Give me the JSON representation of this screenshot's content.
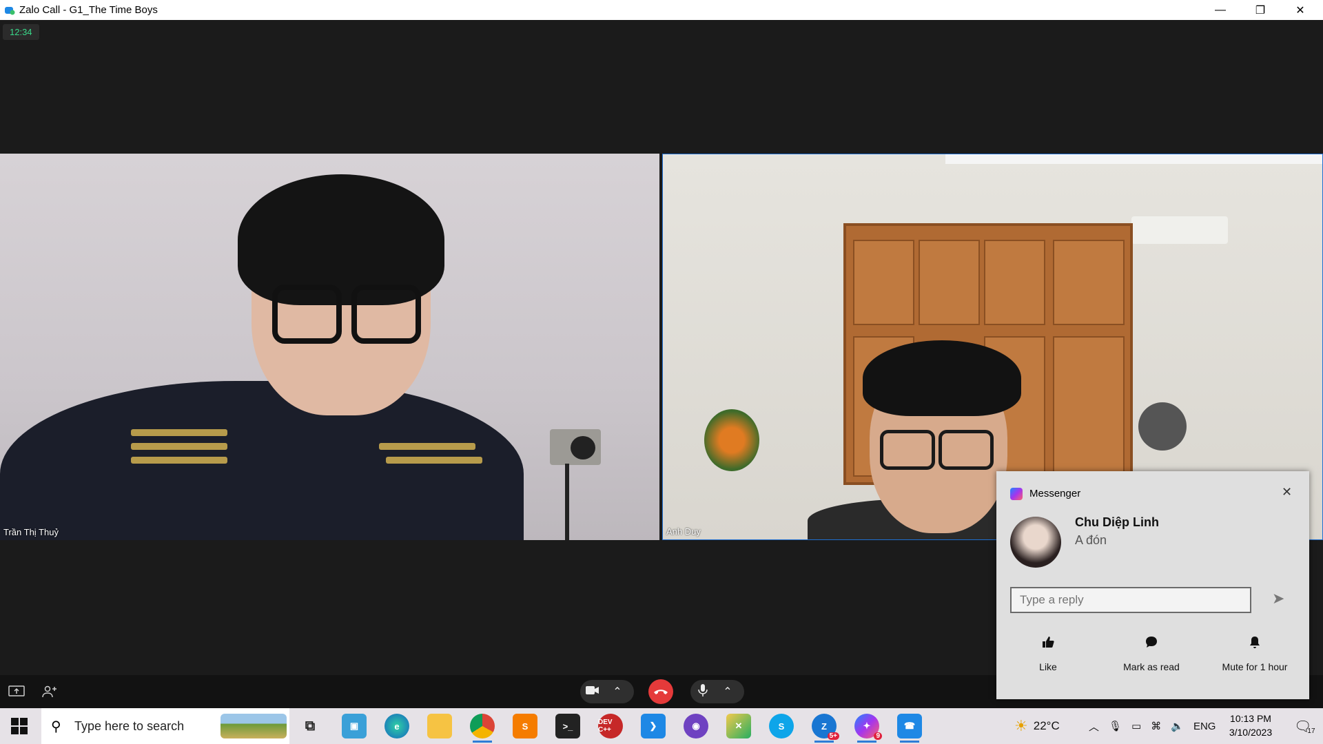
{
  "window": {
    "title": "Zalo Call - G1_The Time Boys",
    "minimize": "—",
    "maximize": "❐",
    "close": "✕"
  },
  "call": {
    "timer": "12:34",
    "participants": [
      {
        "name": "Trần Thị Thuỷ"
      },
      {
        "name": "Anh Duy"
      }
    ]
  },
  "controls": {
    "share_screen_icon": "screen-share-icon",
    "add_people_icon": "add-people-icon",
    "camera_icon": "camera-icon",
    "hangup_icon": "hangup-icon",
    "mic_icon": "mic-icon"
  },
  "notification": {
    "app_name": "Messenger",
    "sender": "Chu Diệp Linh",
    "message": "A đón",
    "reply_placeholder": "Type a reply",
    "actions": [
      {
        "label": "Like",
        "icon": "thumbs-up-icon"
      },
      {
        "label": "Mark as read",
        "icon": "chat-bubble-icon"
      },
      {
        "label": "Mute for 1 hour",
        "icon": "bell-icon"
      }
    ]
  },
  "taskbar": {
    "search_placeholder": "Type here to search",
    "apps": [
      {
        "name": "Task View",
        "icon": "task-view-icon"
      },
      {
        "name": "Snip",
        "icon": "snip-icon"
      },
      {
        "name": "Edge",
        "icon": "edge-icon"
      },
      {
        "name": "File Explorer",
        "icon": "folder-icon"
      },
      {
        "name": "Chrome",
        "icon": "chrome-icon"
      },
      {
        "name": "Sublime Text",
        "icon": "sublime-icon"
      },
      {
        "name": "Terminal",
        "icon": "terminal-icon"
      },
      {
        "name": "Dev-C++",
        "icon": "devcpp-icon",
        "label": "DEV C++"
      },
      {
        "name": "VS Code",
        "icon": "vscode-icon"
      },
      {
        "name": "GitHub Desktop",
        "icon": "github-icon"
      },
      {
        "name": "App",
        "icon": "app-icon"
      },
      {
        "name": "Skype",
        "icon": "skype-icon",
        "label": "S"
      },
      {
        "name": "Zalo",
        "icon": "zalo-icon",
        "badge": "5+"
      },
      {
        "name": "Messenger",
        "icon": "messenger-icon",
        "badge": "9"
      },
      {
        "name": "Zalo Call",
        "icon": "zalo-call-icon"
      }
    ],
    "weather": "22°C",
    "language": "ENG",
    "time": "10:13 PM",
    "date": "3/10/2023",
    "notifications_count": "17"
  },
  "colors": {
    "accent": "#2e7dd7",
    "hangup": "#e53a3a",
    "timer_text": "#39d98a"
  }
}
